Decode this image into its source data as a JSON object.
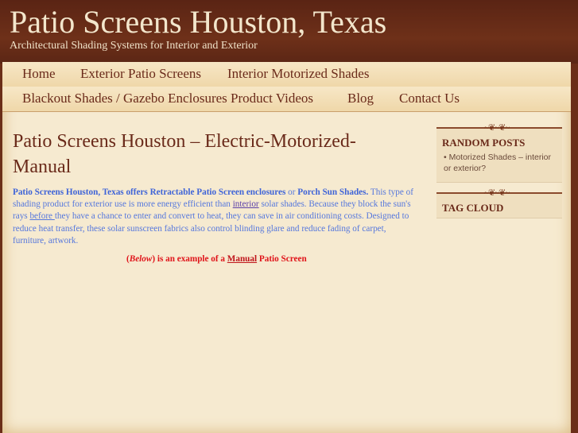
{
  "site": {
    "title": "Patio Screens Houston, Texas",
    "tagline": "Architectural Shading Systems for Interior and Exterior"
  },
  "nav": {
    "row1": [
      "Home",
      "Exterior Patio Screens",
      "Interior Motorized Shades"
    ],
    "row2": [
      "Blackout Shades / Gazebo Enclosures Product Videos",
      "Blog",
      "Contact Us"
    ]
  },
  "post": {
    "title": "Patio Screens Houston – Electric-Motorized-Manual",
    "bold1": "Patio Screens Houston, Texas offers Retractable Patio Screen enclosures",
    "or": " or ",
    "bold2": "Porch Sun Shades.",
    "t1": " This type of shading product for exterior use is more energy efficient than ",
    "link1": "interior",
    "t2": " solar shades. Because they block the sun's rays ",
    "link2": "before ",
    "t3": "they have a chance to enter and convert to heat, they can save in air conditioning costs. Designed to reduce heat transfer, these solar sunscreen fabrics also control blinding glare and reduce fading of carpet, furniture, artwork.",
    "cap_open": "(",
    "cap_below": "Below",
    "cap_mid": ") is an example of a ",
    "cap_link": "Manual",
    "cap_end": " Patio Screen"
  },
  "sidebar": {
    "random_title": "RANDOM POSTS",
    "random_items": [
      "Motorized Shades – interior or exterior?"
    ],
    "tag_title": "TAG CLOUD"
  }
}
